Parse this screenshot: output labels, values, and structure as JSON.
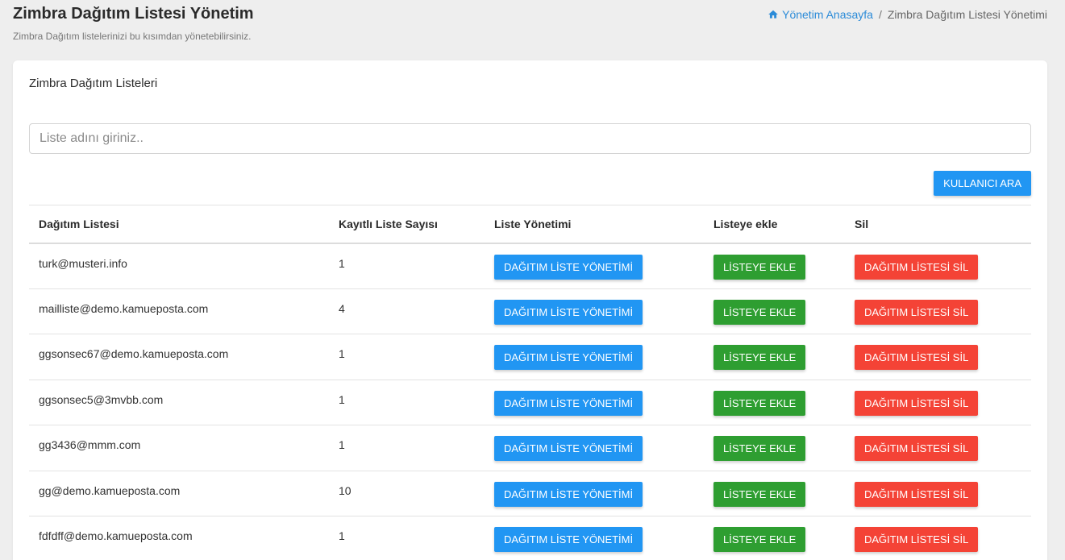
{
  "header": {
    "title": "Zimbra Dağıtım Listesi Yönetim",
    "subtitle": "Zimbra Dağıtım listelerinizi bu kısımdan yönetebilirsiniz."
  },
  "breadcrumb": {
    "home_label": "Yönetim Anasayfa",
    "separator": "/",
    "current": "Zimbra Dağıtım Listesi Yönetimi"
  },
  "card": {
    "title": "Zimbra Dağıtım Listeleri",
    "search_placeholder": "Liste adını giriniz..",
    "search_value": "",
    "search_button": "KULLANICI ARA"
  },
  "table": {
    "headers": [
      "Dağıtım Listesi",
      "Kayıtlı Liste Sayısı",
      "Liste Yönetimi",
      "Listeye ekle",
      "Sil"
    ],
    "rows": [
      {
        "list": "turk@musteri.info",
        "count": "1",
        "manage": "DAĞITIM LİSTE YÖNETİMİ",
        "add": "LİSTEYE EKLE",
        "delete": "DAĞITIM LİSTESİ SİL"
      },
      {
        "list": "mailliste@demo.kamueposta.com",
        "count": "4",
        "manage": "DAĞITIM LİSTE YÖNETİMİ",
        "add": "LİSTEYE EKLE",
        "delete": "DAĞITIM LİSTESİ SİL"
      },
      {
        "list": "ggsonsec67@demo.kamueposta.com",
        "count": "1",
        "manage": "DAĞITIM LİSTE YÖNETİMİ",
        "add": "LİSTEYE EKLE",
        "delete": "DAĞITIM LİSTESİ SİL"
      },
      {
        "list": "ggsonsec5@3mvbb.com",
        "count": "1",
        "manage": "DAĞITIM LİSTE YÖNETİMİ",
        "add": "LİSTEYE EKLE",
        "delete": "DAĞITIM LİSTESİ SİL"
      },
      {
        "list": "gg3436@mmm.com",
        "count": "1",
        "manage": "DAĞITIM LİSTE YÖNETİMİ",
        "add": "LİSTEYE EKLE",
        "delete": "DAĞITIM LİSTESİ SİL"
      },
      {
        "list": "gg@demo.kamueposta.com",
        "count": "10",
        "manage": "DAĞITIM LİSTE YÖNETİMİ",
        "add": "LİSTEYE EKLE",
        "delete": "DAĞITIM LİSTESİ SİL"
      },
      {
        "list": "fdfdff@demo.kamueposta.com",
        "count": "1",
        "manage": "DAĞITIM LİSTE YÖNETİMİ",
        "add": "LİSTEYE EKLE",
        "delete": "DAĞITIM LİSTESİ SİL"
      }
    ]
  },
  "icons": {
    "breadcrumb_home": "home-icon"
  },
  "colors": {
    "primary": "#2196f3",
    "success": "#2e9e31",
    "danger": "#f44336",
    "link": "#2b8bd8"
  }
}
